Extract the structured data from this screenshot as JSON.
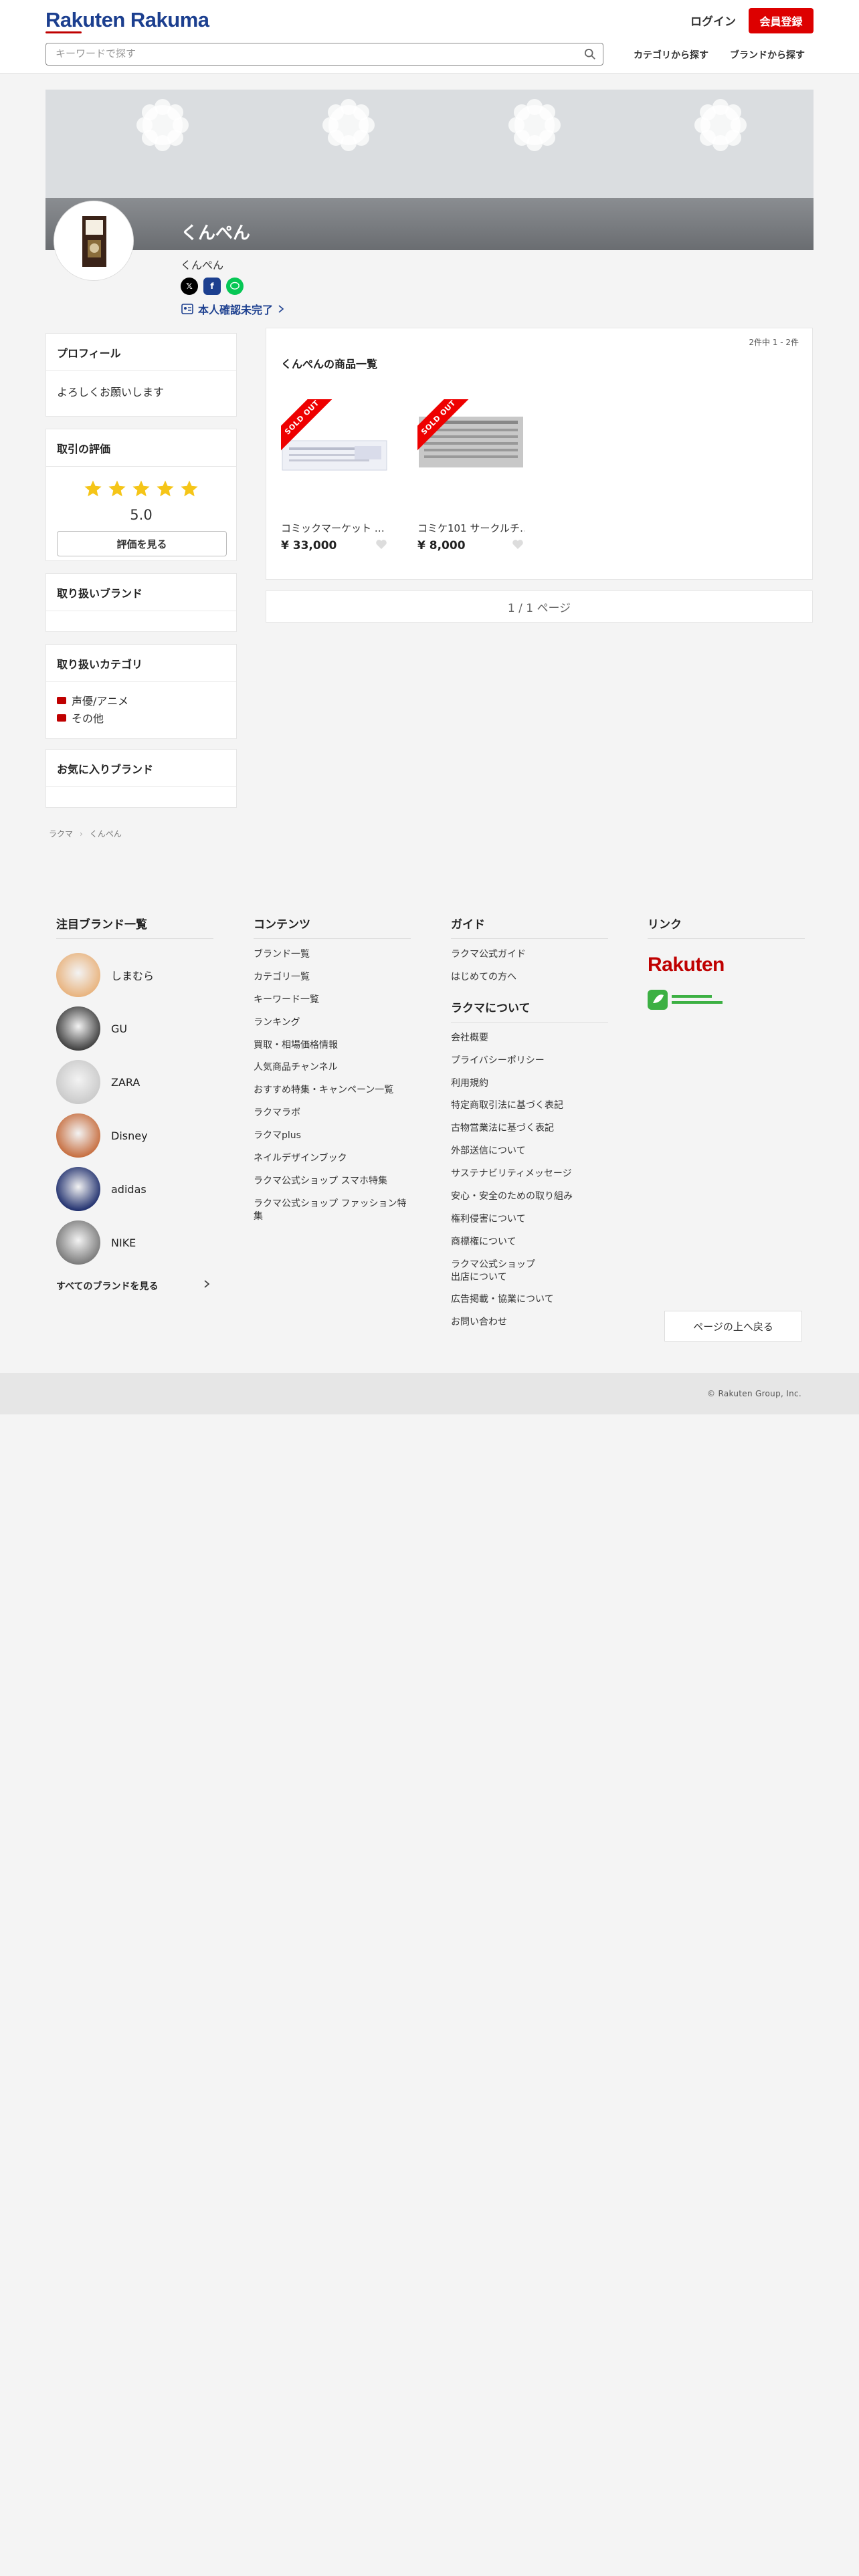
{
  "header": {
    "logo": "Rakuten Rakuma",
    "login_label": "ログイン",
    "register_label": "会員登録",
    "search_placeholder": "キーワードで探す",
    "nav_category": "カテゴリから探す",
    "nav_brand": "ブランドから探す"
  },
  "profile": {
    "name": "くんぺん",
    "handle": "くんぺん",
    "verify_label": "本人確認未完了",
    "share_icons": [
      "x-icon",
      "facebook-icon",
      "line-icon"
    ]
  },
  "sidebar": {
    "profile_title": "プロフィール",
    "profile_text": "よろしくお願いします",
    "rating_title": "取引の評価",
    "rating_stars": 5,
    "rating_score": "5.0",
    "rating_button": "評価を見る",
    "brands_title": "取り扱いブランド",
    "categories_title": "取り扱いカテゴリ",
    "categories": [
      "声優/アニメ",
      "その他"
    ],
    "fav_brands_title": "お気に入りブランド"
  },
  "breadcrumb": [
    "ラクマ",
    "くんぺん"
  ],
  "main": {
    "count_text": "2件中 1 - 2件",
    "title": "くんぺんの商品一覧",
    "sold_label": "SOLD OUT",
    "products": [
      {
        "name": "コミックマーケット …",
        "price": "¥ 33,000"
      },
      {
        "name": "コミケ101 サークルチ…",
        "price": "¥ 8,000"
      }
    ],
    "pagination": "1 / 1 ページ"
  },
  "footer": {
    "brands_title": "注目ブランド一覧",
    "brands": [
      "しまむら",
      "GU",
      "ZARA",
      "Disney",
      "adidas",
      "NIKE"
    ],
    "see_all": "すべてのブランドを見る",
    "contents_title": "コンテンツ",
    "contents": [
      "ブランド一覧",
      "カテゴリ一覧",
      "キーワード一覧",
      "ランキング",
      "買取・相場価格情報",
      "人気商品チャンネル",
      "おすすめ特集・キャンペーン一覧",
      "ラクマラボ",
      "ラクマplus",
      "ネイルデザインブック",
      "ラクマ公式ショップ スマホ特集",
      "ラクマ公式ショップ ファッション特集"
    ],
    "guide_title": "ガイド",
    "guide": [
      "ラクマ公式ガイド",
      "はじめての方へ"
    ],
    "about_title": "ラクマについて",
    "about": [
      "会社概要",
      "プライバシーポリシー",
      "利用規約",
      "特定商取引法に基づく表記",
      "古物営業法に基づく表記",
      "外部送信について",
      "サステナビリティメッセージ",
      "安心・安全のための取り組み",
      "権利侵害について",
      "商標権について",
      "ラクマ公式ショップ\n出店について",
      "広告掲載・協業について",
      "お問い合わせ"
    ],
    "links_title": "リンク",
    "rakuten_logo": "Rakuten",
    "back_to_top": "ページの上へ戻る",
    "copyright": "© Rakuten Group, Inc."
  },
  "colors": {
    "brand_red": "#bf0000",
    "register_red": "#dd0000",
    "logo_blue": "#1c3f8f",
    "star_yellow": "#f5c518"
  }
}
